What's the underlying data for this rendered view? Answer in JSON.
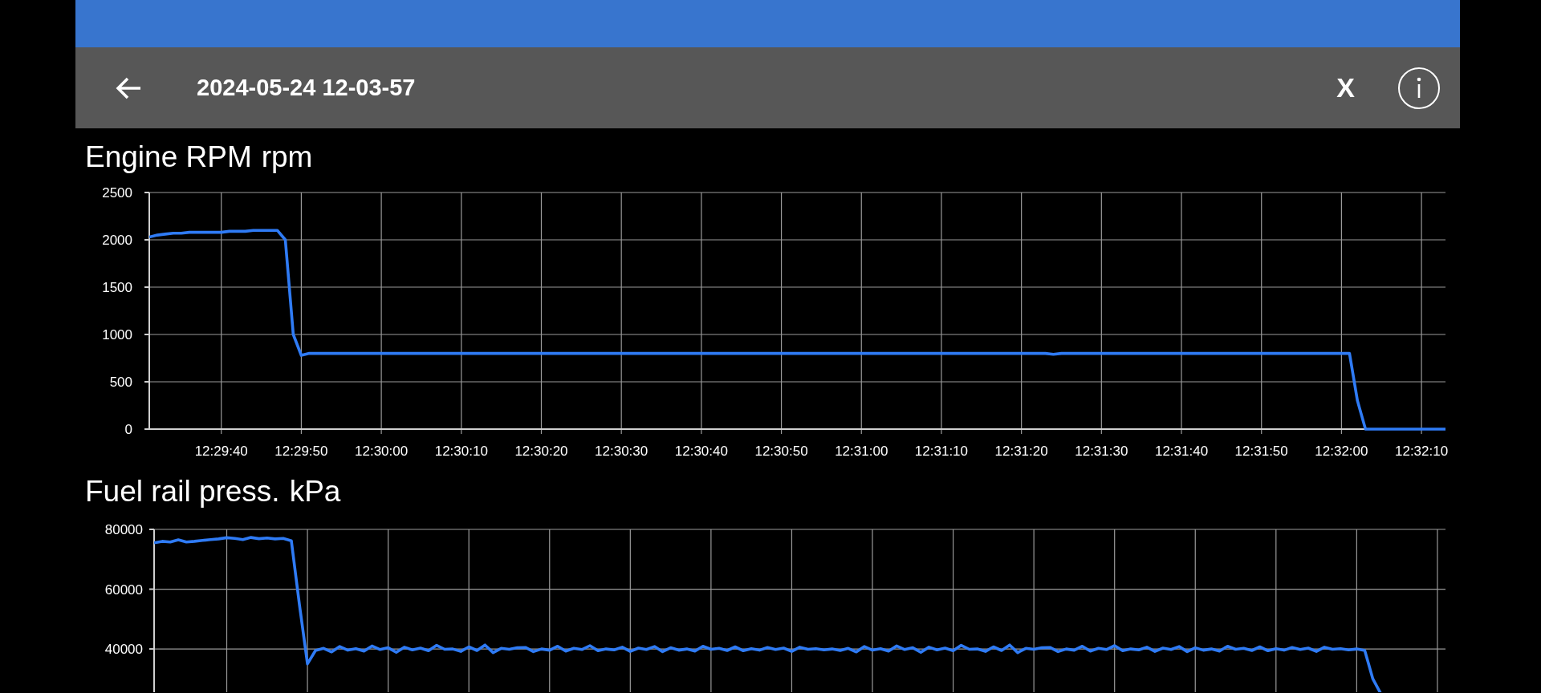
{
  "app_bar": {
    "title": "2024-05-24 12-03-57",
    "close_label": "X"
  },
  "charts": [
    {
      "chart_data": {
        "type": "line",
        "grid": true,
        "ylabel": "rpm",
        "ylim": [
          0,
          2500
        ],
        "yticks": [
          0,
          500,
          1000,
          1500,
          2000,
          2500
        ],
        "categories": [
          null,
          null,
          null,
          null,
          null,
          null,
          null,
          null,
          null,
          "12:29:40",
          null,
          null,
          null,
          null,
          null,
          null,
          null,
          null,
          null,
          "12:29:50",
          null,
          null,
          null,
          null,
          null,
          null,
          null,
          null,
          null,
          "12:30:00",
          null,
          null,
          null,
          null,
          null,
          null,
          null,
          null,
          null,
          "12:30:10",
          null,
          null,
          null,
          null,
          null,
          null,
          null,
          null,
          null,
          "12:30:20",
          null,
          null,
          null,
          null,
          null,
          null,
          null,
          null,
          null,
          "12:30:30",
          null,
          null,
          null,
          null,
          null,
          null,
          null,
          null,
          null,
          "12:30:40",
          null,
          null,
          null,
          null,
          null,
          null,
          null,
          null,
          null,
          "12:30:50",
          null,
          null,
          null,
          null,
          null,
          null,
          null,
          null,
          null,
          "12:31:00",
          null,
          null,
          null,
          null,
          null,
          null,
          null,
          null,
          null,
          "12:31:10",
          null,
          null,
          null,
          null,
          null,
          null,
          null,
          null,
          null,
          "12:31:20",
          null,
          null,
          null,
          null,
          null,
          null,
          null,
          null,
          null,
          "12:31:30",
          null,
          null,
          null,
          null,
          null,
          null,
          null,
          null,
          null,
          "12:31:40",
          null,
          null,
          null,
          null,
          null,
          null,
          null,
          null,
          null,
          "12:31:50",
          null,
          null,
          null,
          null,
          null,
          null,
          null,
          null,
          null,
          "12:32:00",
          null,
          null,
          null,
          null,
          null,
          null,
          null,
          null,
          null,
          "12:32:10",
          null,
          null,
          null
        ],
        "series": [
          {
            "name": "Engine RPM",
            "color": "#2f7bf5",
            "values": [
              2030,
              2050,
              2060,
              2070,
              2070,
              2080,
              2080,
              2080,
              2080,
              2080,
              2090,
              2090,
              2090,
              2100,
              2100,
              2100,
              2100,
              2000,
              1000,
              780,
              800,
              800,
              800,
              800,
              800,
              800,
              800,
              800,
              800,
              800,
              800,
              800,
              800,
              800,
              800,
              800,
              800,
              800,
              800,
              800,
              800,
              800,
              800,
              800,
              800,
              800,
              800,
              800,
              800,
              800,
              800,
              800,
              800,
              800,
              800,
              800,
              800,
              800,
              800,
              800,
              800,
              800,
              800,
              800,
              800,
              800,
              800,
              800,
              800,
              800,
              800,
              800,
              800,
              800,
              800,
              800,
              800,
              800,
              800,
              800,
              800,
              800,
              800,
              800,
              800,
              800,
              800,
              800,
              800,
              800,
              800,
              800,
              800,
              800,
              800,
              800,
              800,
              800,
              800,
              800,
              800,
              800,
              800,
              800,
              800,
              800,
              800,
              800,
              800,
              800,
              800,
              800,
              800,
              790,
              800,
              800,
              800,
              800,
              800,
              800,
              800,
              800,
              800,
              800,
              800,
              800,
              800,
              800,
              800,
              800,
              800,
              800,
              800,
              800,
              800,
              800,
              800,
              800,
              800,
              800,
              800,
              800,
              800,
              800,
              800,
              800,
              800,
              800,
              800,
              800,
              800,
              300,
              0,
              0,
              0,
              0,
              0,
              0,
              0,
              0,
              0,
              0,
              0
            ]
          }
        ]
      }
    },
    {
      "chart_data": {
        "type": "line",
        "grid": true,
        "ylabel": "kPa",
        "ylim": [
          25000,
          80000
        ],
        "yticks": [
          40000,
          60000,
          80000
        ],
        "categories": [
          null,
          null,
          null,
          null,
          null,
          null,
          null,
          null,
          null,
          null,
          null,
          null,
          null,
          null,
          null,
          null,
          null,
          null,
          null,
          null,
          null,
          null,
          null,
          null,
          null,
          null,
          null,
          null,
          null,
          null,
          null,
          null,
          null,
          null,
          null,
          null,
          null,
          null,
          null,
          null,
          null,
          null,
          null,
          null,
          null,
          null,
          null,
          null,
          null,
          null,
          null,
          null,
          null,
          null,
          null,
          null,
          null,
          null,
          null,
          null,
          null,
          null,
          null,
          null,
          null,
          null,
          null,
          null,
          null,
          null,
          null,
          null,
          null,
          null,
          null,
          null,
          null,
          null,
          null,
          null,
          null,
          null,
          null,
          null,
          null,
          null,
          null,
          null,
          null,
          null,
          null,
          null,
          null,
          null,
          null,
          null,
          null,
          null,
          null,
          null,
          null,
          null,
          null,
          null,
          null,
          null,
          null,
          null,
          null,
          null,
          null,
          null,
          null,
          null,
          null,
          null,
          null,
          null,
          null,
          null,
          null,
          null,
          null,
          null,
          null,
          null,
          null,
          null,
          null,
          null,
          null,
          null,
          null,
          null,
          null,
          null,
          null,
          null,
          null,
          null,
          null,
          null,
          null,
          null,
          null,
          null,
          null,
          null,
          null,
          null,
          null,
          null,
          null,
          null,
          null,
          null,
          null,
          null,
          null,
          null,
          null
        ],
        "series": [
          {
            "name": "Fuel rail press.",
            "color": "#2f7bf5",
            "values": [
              75500,
              76000,
              75800,
              76500,
              75800,
              76000,
              76300,
              76600,
              76800,
              77200,
              77000,
              76600,
              77300,
              76900,
              77100,
              76800,
              77000,
              76200,
              55000,
              35000,
              39500,
              40200,
              39000,
              40800,
              39600,
              40100,
              39300,
              41000,
              39800,
              40400,
              38900,
              40600,
              39700,
              40300,
              39400,
              41200,
              39900,
              40000,
              39200,
              40700,
              39500,
              41300,
              38800,
              40200,
              39900,
              40400,
              40500,
              39100,
              40000,
              39600,
              40900,
              39300,
              40200,
              39800,
              41100,
              39400,
              40000,
              39700,
              40600,
              39200,
              40300,
              39800,
              40800,
              39100,
              40400,
              39600,
              40000,
              39300,
              40900,
              39900,
              40200,
              39500,
              40700,
              39400,
              40100,
              39600,
              40500,
              39800,
              40300,
              39200,
              40600,
              39900,
              40100,
              39700,
              40000,
              39500,
              40200,
              39000,
              40800,
              39600,
              40100,
              39300,
              41000,
              39800,
              40400,
              38900,
              40600,
              39700,
              40300,
              39400,
              41200,
              39900,
              40000,
              39200,
              40700,
              39500,
              41300,
              38800,
              40200,
              39900,
              40400,
              40500,
              39100,
              40000,
              39600,
              40900,
              39300,
              40200,
              39800,
              41100,
              39400,
              40000,
              39700,
              40600,
              39200,
              40300,
              39800,
              40800,
              39100,
              40400,
              39600,
              40000,
              39300,
              40900,
              39900,
              40200,
              39500,
              40700,
              39400,
              40100,
              39600,
              40500,
              39800,
              40300,
              39200,
              40600,
              39900,
              40100,
              39700,
              40000,
              39500,
              30000,
              25000,
              null,
              null,
              null,
              null,
              null,
              null,
              null,
              null
            ]
          }
        ]
      }
    }
  ]
}
